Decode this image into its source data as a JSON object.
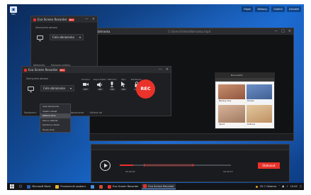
{
  "desktop": {
    "icon_label": "Icn",
    "top_strip": [
      "Ripan",
      "Webovy",
      "Ostatni",
      "Uzivatel"
    ]
  },
  "recorder_back": {
    "title": "Eva Screen Recorder",
    "badge": "PRO",
    "capture_label": "Zachyceni obrazu",
    "screen_combo": "Cela obrazovka",
    "links": [
      "Nahravky",
      "Spravce snimku"
    ]
  },
  "dark_window": {
    "title": "Nahravka",
    "address": "C:\\Users\\Video\\Nahravka.mp4"
  },
  "recorder_front": {
    "title": "Eva Screen Recorder",
    "badge": "PRO",
    "capture_label": "Zachyceni obrazu",
    "screen_combo": "Cela obrazovka",
    "controls": [
      {
        "label": "Kamera",
        "value": "OFF"
      },
      {
        "label": "Reproduktor",
        "value": "ON"
      },
      {
        "label": "Mikrofon",
        "value": "ON"
      },
      {
        "label": "Mys",
        "value": "ON"
      },
      {
        "label": "Nastaveni",
        "value": "ON"
      }
    ],
    "rec_label": "REC",
    "links": [
      "Nastaveni",
      "Zahajit nahravani",
      "Naplanovat",
      "Uklada do"
    ]
  },
  "dropdown": {
    "items": [
      "Cela obrazovka",
      "Vlastni oblast",
      "Aktivni okno",
      "Pevna velikost",
      "Kamera a obraz",
      "Pouze zvuk"
    ],
    "selected_index": 2
  },
  "browser": {
    "title": "Nova karta",
    "cards": [
      {
        "caption": "Zpravy dne"
      },
      {
        "caption": "Pocasi"
      },
      {
        "caption": "Sport"
      },
      {
        "caption": "Kultura"
      }
    ]
  },
  "player": {
    "time_start": "00:00:00",
    "time_end": "00:00:15",
    "progress": 0.12,
    "download_label": "Stahnout"
  },
  "taskbar": {
    "items": [
      "",
      "Microsoft Word",
      "Pruzkumnik souboru",
      "",
      "",
      "Eva Screen Recorder",
      "Eva Screen Recorder"
    ],
    "tray_text": "25 C Oblacno",
    "time": "10:45"
  },
  "colors": {
    "accent": "#e8322a",
    "desktop": "#124a94"
  }
}
